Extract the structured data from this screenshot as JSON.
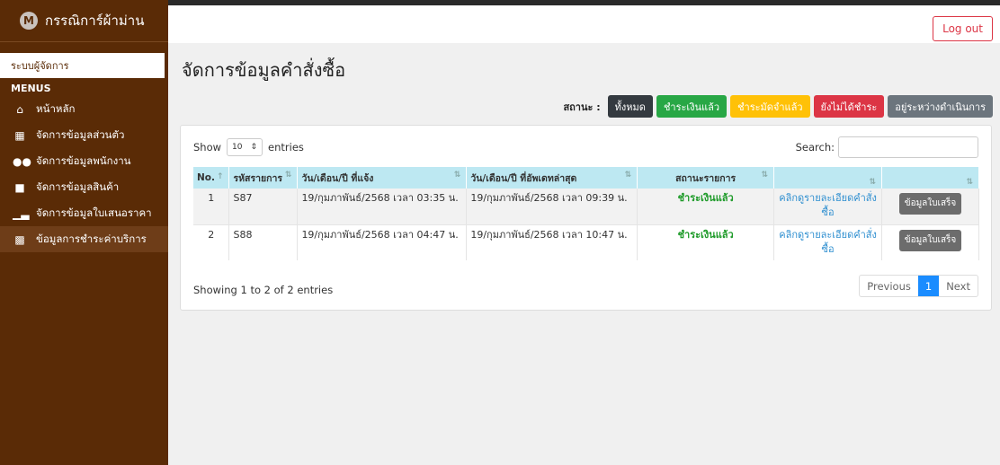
{
  "brand": {
    "logo_letter": "M",
    "name": "กรรณิการ์ผ้าม่าน"
  },
  "sidebar": {
    "system_label": "ระบบผู้จัดการ",
    "menus_heading": "MENUS",
    "items": [
      {
        "label": "หน้าหลัก",
        "icon": "home-icon"
      },
      {
        "label": "จัดการข้อมูลส่วนตัว",
        "icon": "id-card-icon"
      },
      {
        "label": "จัดการข้อมูลพนักงาน",
        "icon": "users-icon"
      },
      {
        "label": "จัดการข้อมูลสินค้า",
        "icon": "shirt-icon"
      },
      {
        "label": "จัดการข้อมูลใบเสนอราคา",
        "icon": "chart-icon"
      },
      {
        "label": "ข้อมูลการชำระค่าบริการ",
        "icon": "truck-icon"
      }
    ]
  },
  "topbar": {
    "logout_label": "Log out"
  },
  "page": {
    "title": "จัดการข้อมูลคำสั่งซื้อ"
  },
  "status_filter": {
    "label": "สถานะ :",
    "buttons": [
      {
        "label": "ทั้งหมด",
        "color": "#343a40"
      },
      {
        "label": "ชำระเงินแล้ว",
        "color": "#28a745"
      },
      {
        "label": "ชำระมัดจำแล้ว",
        "color": "#ffc107"
      },
      {
        "label": "ยังไม่ได้ชำระ",
        "color": "#dc3545"
      },
      {
        "label": "อยู่ระหว่างดำเนินการ",
        "color": "#6c757d"
      }
    ]
  },
  "table_controls": {
    "show_label": "Show",
    "entries_value": "10",
    "entries_label": "entries",
    "search_label": "Search:"
  },
  "table": {
    "headers": [
      "No.",
      "รหัสรายการ",
      "วัน/เดือน/ปี ที่แจ้ง",
      "วัน/เดือน/ปี ที่อัพเดทล่าสุด",
      "สถานะรายการ",
      "",
      ""
    ],
    "rows": [
      {
        "no": "1",
        "code": "S87",
        "created": "19/กุมภาพันธ์/2568 เวลา 03:35 น.",
        "updated": "19/กุมภาพันธ์/2568 เวลา 09:39 น.",
        "status": "ชำระเงินแล้ว",
        "detail": "คลิกดูรายละเอียดคำสั่งซื้อ",
        "action": "ข้อมูลใบเสร็จ"
      },
      {
        "no": "2",
        "code": "S88",
        "created": "19/กุมภาพันธ์/2568 เวลา 04:47 น.",
        "updated": "19/กุมภาพันธ์/2568 เวลา 10:47 น.",
        "status": "ชำระเงินแล้ว",
        "detail": "คลิกดูรายละเอียดคำสั่งซื้อ",
        "action": "ข้อมูลใบเสร็จ"
      }
    ]
  },
  "footer": {
    "showing": "Showing 1 to 2 of 2 entries",
    "previous": "Previous",
    "page": "1",
    "next": "Next"
  }
}
